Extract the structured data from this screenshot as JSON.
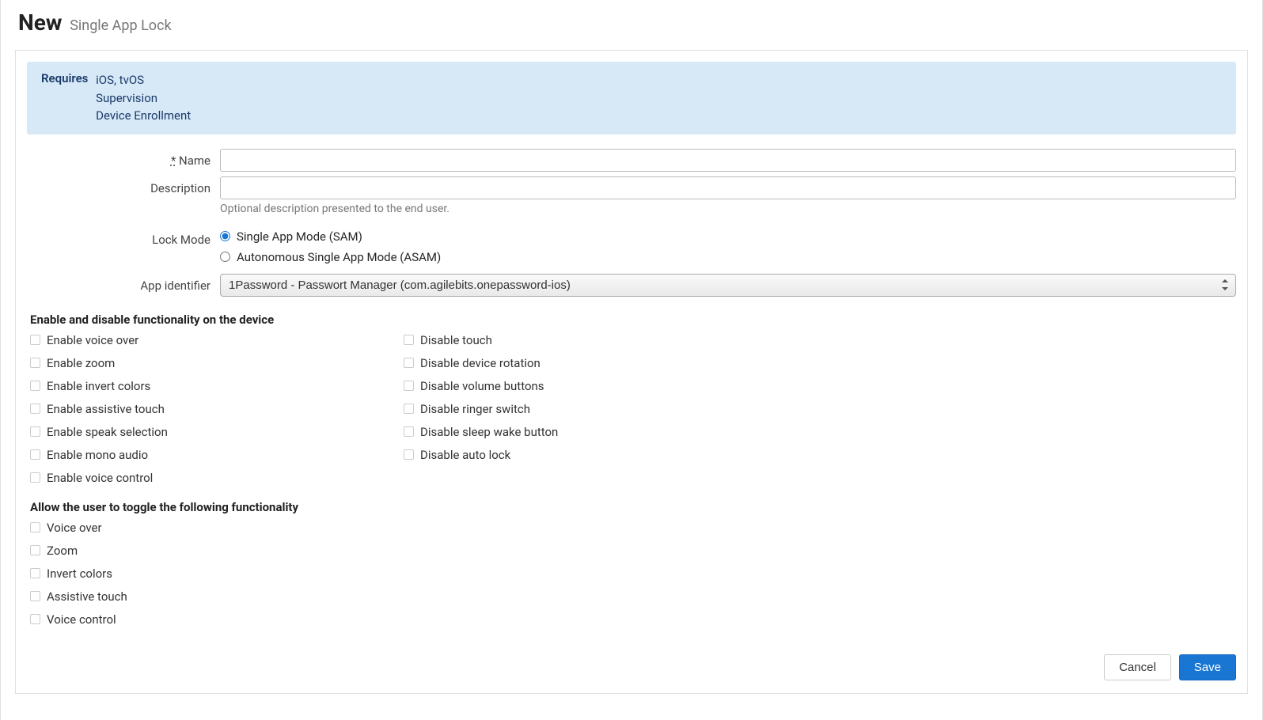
{
  "header": {
    "title": "New",
    "subtitle": "Single App Lock"
  },
  "requires": {
    "label": "Requires",
    "items": [
      "iOS, tvOS",
      "Supervision",
      "Device Enrollment"
    ]
  },
  "form": {
    "name_label": "Name",
    "required_mark": "*",
    "name_value": "",
    "description_label": "Description",
    "description_value": "",
    "description_help": "Optional description presented to the end user.",
    "lock_mode_label": "Lock Mode",
    "lock_mode_options": {
      "sam": "Single App Mode (SAM)",
      "asam": "Autonomous Single App Mode (ASAM)"
    },
    "lock_mode_selected": "sam",
    "app_identifier_label": "App identifier",
    "app_identifier_value": "1Password - Passwort Manager (com.agilebits.onepassword-ios)"
  },
  "functionality_section": {
    "heading": "Enable and disable functionality on the device",
    "col1": [
      "Enable voice over",
      "Enable zoom",
      "Enable invert colors",
      "Enable assistive touch",
      "Enable speak selection",
      "Enable mono audio",
      "Enable voice control"
    ],
    "col2": [
      "Disable touch",
      "Disable device rotation",
      "Disable volume buttons",
      "Disable ringer switch",
      "Disable sleep wake button",
      "Disable auto lock"
    ]
  },
  "toggle_section": {
    "heading": "Allow the user to toggle the following functionality",
    "items": [
      "Voice over",
      "Zoom",
      "Invert colors",
      "Assistive touch",
      "Voice control"
    ]
  },
  "footer": {
    "cancel": "Cancel",
    "save": "Save"
  }
}
